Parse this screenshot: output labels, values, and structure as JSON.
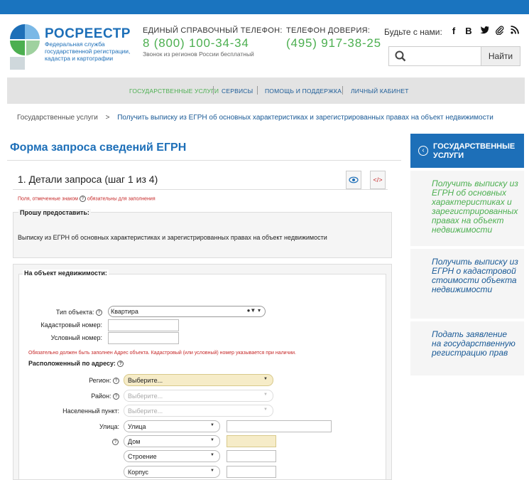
{
  "header": {
    "logo_title": "РОСРЕЕСТР",
    "logo_subtitle": "Федеральная служба государственной регистрации, кадастра и картографии",
    "phone1_label": "ЕДИНЫЙ СПРАВОЧНЫЙ ТЕЛЕФОН:",
    "phone1_number": "8 (800) 100-34-34",
    "phone1_note": "Звонок из регионов России бесплатный",
    "phone2_label": "ТЕЛЕФОН ДОВЕРИЯ:",
    "phone2_number": "(495) 917-38-25",
    "social_label": "Будьте с нами:",
    "social": [
      "f",
      "B",
      "twitter-icon",
      "clip-icon",
      "rss-icon"
    ],
    "search_placeholder": "",
    "search_button": "Найти"
  },
  "nav": {
    "items": [
      {
        "label": "ГОСУДАРСТВЕННЫЕ УСЛУГИ",
        "active": true
      },
      {
        "label": "СЕРВИСЫ",
        "active": false
      },
      {
        "label": "ПОМОЩЬ И ПОДДЕРЖКА",
        "active": false
      },
      {
        "label": "ЛИЧНЫЙ КАБИНЕТ",
        "active": false
      }
    ]
  },
  "breadcrumb": {
    "home": "Государственные услуги",
    "separator": ">",
    "current": "Получить выписку из ЕГРН об основных характеристиках и зарегистрированных правах на объект недвижимости"
  },
  "form": {
    "page_title": "Форма запроса сведений ЕГРН",
    "step_title": "1. Детали запроса (шаг 1 из 4)",
    "required_note_pre": "Поля, отмеченные знаком",
    "required_note_post": "обязательны для заполнения",
    "provide_legend": "Прошу предоставить:",
    "provide_text": "Выписку из ЕГРН об основных характеристиках и зарегистрированных правах на объект недвижимости",
    "object_legend": "На объект недвижимости:",
    "object_type_label": "Тип объекта:",
    "object_type_value": "Квартира",
    "cadastral_label": "Кадастровый номер:",
    "cadastral_value": "",
    "conditional_label": "Условный номер:",
    "conditional_value": "",
    "address_warning": "Обязательно должен быть заполнен Адрес объекта. Кадастровый (или условный) номер указывается при наличии.",
    "address_title": "Расположенный по адресу:",
    "region_label": "Регион:",
    "region_value": "Выберите...",
    "district_label": "Район:",
    "district_value": "Выберите...",
    "locality_label": "Населенный пункт:",
    "locality_value": "Выберите...",
    "street_label": "Улица:",
    "street_type": "Улица",
    "street_value": "",
    "house_type": "Дом",
    "house_value": "",
    "building_type": "Строение",
    "building_value": "",
    "corpus_type": "Корпус",
    "corpus_value": ""
  },
  "sidebar": {
    "header": "ГОСУДАРСТВЕННЫЕ УСЛУГИ",
    "items": [
      {
        "label": "Получить выписку из ЕГРН об основных характеристиках и зарегистрированных правах на объект недвижимости",
        "active": true
      },
      {
        "label": "Получить выписку из ЕГРН о кадастровой стоимости объекта недвижимости",
        "active": false
      },
      {
        "label": "Подать заявление на государственную регистрацию прав",
        "active": false
      }
    ]
  },
  "colors": {
    "brand_blue": "#1d6fb8",
    "accent_green": "#4caf50",
    "required_red": "#c62828"
  }
}
